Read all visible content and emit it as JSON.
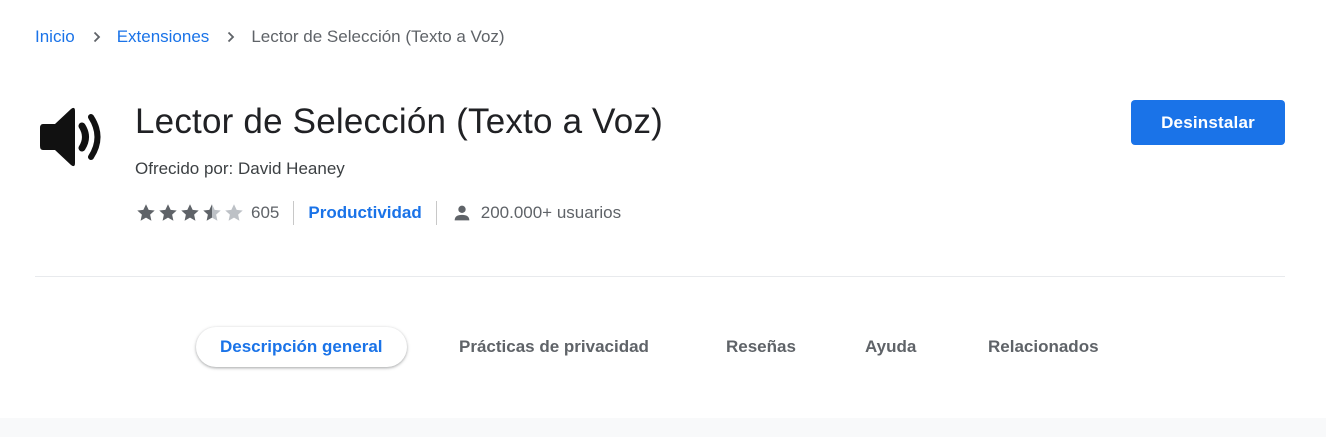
{
  "breadcrumb": {
    "home": "Inicio",
    "section": "Extensiones",
    "current": "Lector de Selección (Texto a Voz)"
  },
  "extension": {
    "icon": "speaker-volume-icon",
    "title": "Lector de Selección (Texto a Voz)",
    "offered_by": "Ofrecido por: David Heaney",
    "rating": 3.5,
    "rating_max": 5,
    "rating_count": "605",
    "category": "Productividad",
    "users": "200.000+ usuarios"
  },
  "actions": {
    "uninstall_label": "Desinstalar"
  },
  "tabs": [
    {
      "label": "Descripción general",
      "active": true
    },
    {
      "label": "Prácticas de privacidad",
      "active": false
    },
    {
      "label": "Reseñas",
      "active": false
    },
    {
      "label": "Ayuda",
      "active": false
    },
    {
      "label": "Relacionados",
      "active": false
    }
  ],
  "colors": {
    "accent": "#1a73e8",
    "star_filled": "#5f6368",
    "star_empty": "#bdc1c6"
  }
}
